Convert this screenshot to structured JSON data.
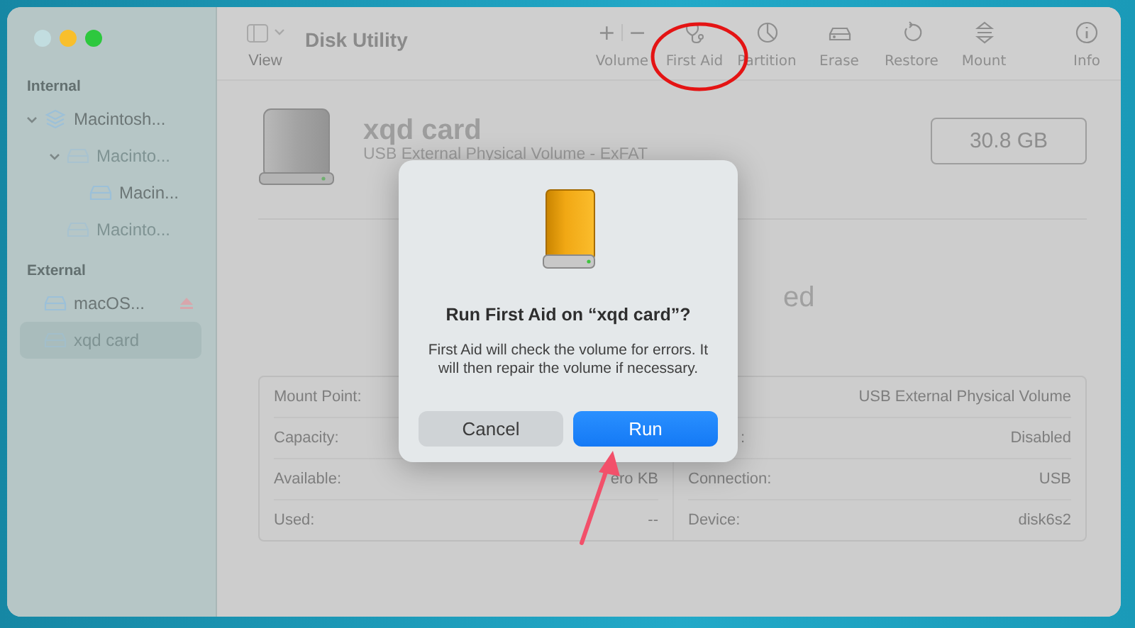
{
  "window": {
    "title": "Disk Utility"
  },
  "sidebar": {
    "sections": [
      {
        "header": "Internal",
        "items": [
          {
            "label": "Macintosh...",
            "kind": "container",
            "expanded": true,
            "dimmed": false,
            "selected": false,
            "ejectable": false,
            "children": [
              {
                "label": "Macinto...",
                "kind": "volume",
                "expanded": true,
                "dimmed": true,
                "selected": false,
                "ejectable": false,
                "children": [
                  {
                    "label": "Macin...",
                    "kind": "volume",
                    "dimmed": false,
                    "selected": false,
                    "ejectable": false
                  }
                ]
              },
              {
                "label": "Macinto...",
                "kind": "volume",
                "dimmed": true,
                "selected": false,
                "ejectable": false
              }
            ]
          }
        ]
      },
      {
        "header": "External",
        "items": [
          {
            "label": "macOS...",
            "kind": "volume",
            "dimmed": false,
            "selected": false,
            "ejectable": true
          },
          {
            "label": "xqd card",
            "kind": "volume",
            "dimmed": true,
            "selected": true,
            "ejectable": false
          }
        ]
      }
    ]
  },
  "toolbar": {
    "view_label": "View",
    "items": [
      {
        "kind": "add-remove",
        "glyphs": [
          "+",
          "−"
        ],
        "label": "Volume"
      },
      {
        "kind": "first-aid",
        "label": "First Aid"
      },
      {
        "kind": "partition",
        "label": "Partition"
      },
      {
        "kind": "erase",
        "label": "Erase"
      },
      {
        "kind": "restore",
        "label": "Restore"
      },
      {
        "kind": "mount",
        "label": "Mount"
      },
      {
        "kind": "info",
        "label": "Info"
      }
    ]
  },
  "device": {
    "name": "xqd card",
    "description": "USB External Physical Volume - ExFAT",
    "size": "30.8 GB",
    "status": "ed"
  },
  "info_table": {
    "rows": [
      {
        "left": {
          "label": "Mount Point:"
        },
        "right": {
          "value": "USB External Physical Volume"
        }
      },
      {
        "left": {
          "label": "Capacity:"
        },
        "right": {
          "label": ":",
          "value": "Disabled"
        }
      },
      {
        "left": {
          "label": "Available:",
          "value": "ero KB"
        },
        "right": {
          "label": "Connection:",
          "value": "USB"
        }
      },
      {
        "left": {
          "label": "Used:",
          "value": "--"
        },
        "right": {
          "label": "Device:",
          "value": "disk6s2"
        }
      }
    ]
  },
  "dialog": {
    "title": "Run First Aid on “xqd card”?",
    "message": "First Aid will check the volume for errors. It will then repair the volume if necessary.",
    "buttons": [
      {
        "label": "Cancel",
        "default": false
      },
      {
        "label": "Run",
        "default": true
      }
    ]
  }
}
